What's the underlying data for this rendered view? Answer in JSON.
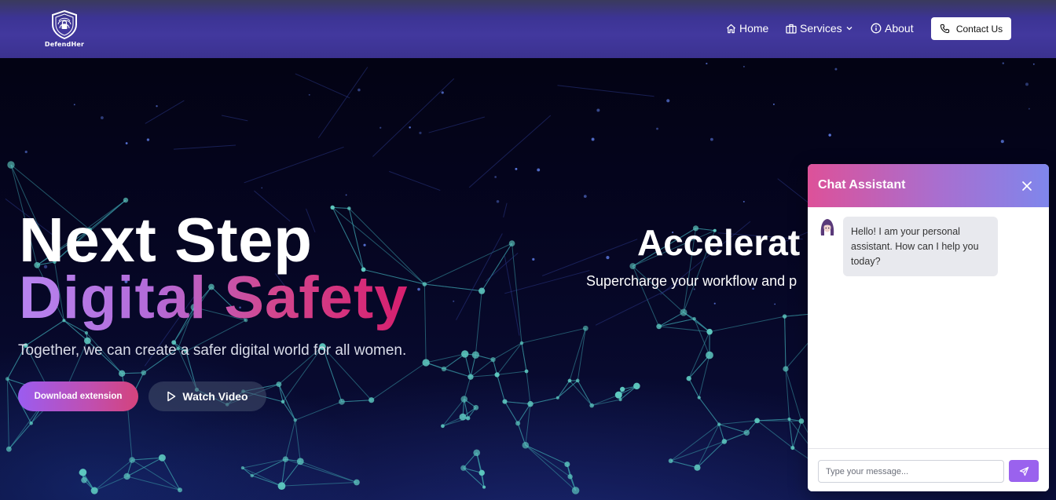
{
  "brand": {
    "name": "DefendHer"
  },
  "nav": {
    "items": [
      {
        "label": "Home",
        "icon": "home-icon"
      },
      {
        "label": "Services",
        "icon": "briefcase-icon",
        "dropdown": true
      },
      {
        "label": "About",
        "icon": "info-icon"
      }
    ],
    "contact_label": "Contact Us",
    "contact_icon": "phone-icon"
  },
  "hero": {
    "title_line1": "Next Step",
    "title_line2": "Digital Safety",
    "subtitle": "Together, we can create a safer digital world for all women.",
    "download_label": "Download extension",
    "watch_label": "Watch Video",
    "slide_title": "Accelerat",
    "slide_subtitle": "Supercharge your workflow and p"
  },
  "chat": {
    "title": "Chat Assistant",
    "greeting": "Hello! I am your personal assistant. How can I help you today?",
    "input_placeholder": "Type your message...",
    "input_value": ""
  },
  "colors": {
    "nav_bg": "#3c3494",
    "accent_purple": "#9a62ee",
    "accent_pink": "#d61f6e",
    "chat_header_start": "#dd5199",
    "chat_header_end": "#7f86ec"
  }
}
